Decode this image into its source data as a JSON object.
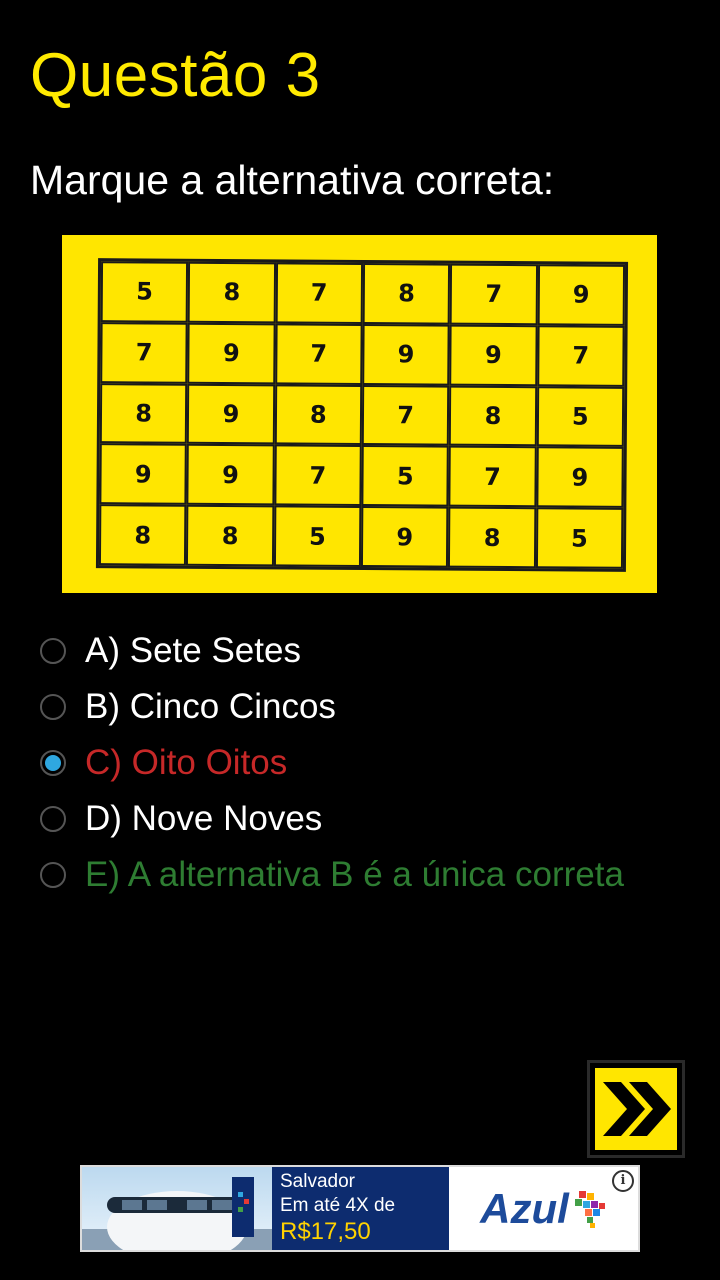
{
  "question": {
    "title": "Questão 3",
    "prompt": "Marque a alternativa correta:"
  },
  "puzzle_grid": [
    [
      "5",
      "8",
      "7",
      "8",
      "7",
      "9"
    ],
    [
      "7",
      "9",
      "7",
      "9",
      "9",
      "7"
    ],
    [
      "8",
      "9",
      "8",
      "7",
      "8",
      "5"
    ],
    [
      "9",
      "9",
      "7",
      "5",
      "7",
      "9"
    ],
    [
      "8",
      "8",
      "5",
      "9",
      "8",
      "5"
    ]
  ],
  "options": [
    {
      "label": "A) Sete Setes",
      "color": "#ffffff",
      "selected": false
    },
    {
      "label": "B) Cinco Cincos",
      "color": "#ffffff",
      "selected": false
    },
    {
      "label": "C) Oito Oitos",
      "color": "#c62828",
      "selected": true
    },
    {
      "label": "D) Nove Noves",
      "color": "#ffffff",
      "selected": false
    },
    {
      "label": "E) A alternativa B é a única correta",
      "color": "#2e7d32",
      "selected": false
    }
  ],
  "next_button": {
    "icon": "double-chevron-right-icon"
  },
  "ad": {
    "line1": "Salvador",
    "line2": "Em até 4X de",
    "price": "R$17,50",
    "brand": "Azul",
    "info_icon": "i"
  },
  "colors": {
    "accent_yellow": "#ffea00",
    "selected_radio": "#2fa7e0",
    "background": "#000000"
  }
}
